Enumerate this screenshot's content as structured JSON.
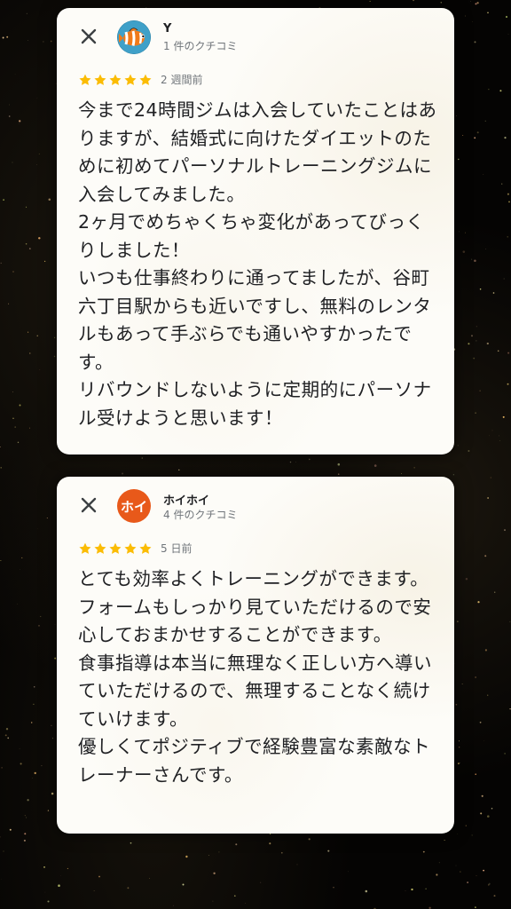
{
  "reviews": [
    {
      "reviewer_name": "Y",
      "review_count": "1 件のクチコミ",
      "rating": 5,
      "time_ago": "2 週間前",
      "avatar_icon": "clownfish-avatar",
      "text": "今まで24時間ジムは入会していたことはありますが、結婚式に向けたダイエットのために初めてパーソナルトレーニングジムに入会してみました。\n2ヶ月でめちゃくちゃ変化があってびっくりしました！\nいつも仕事終わりに通ってましたが、谷町六丁目駅からも近いですし、無料のレンタルもあって手ぶらでも通いやすかったです。\nリバウンドしないように定期的にパーソナル受けようと思います！"
    },
    {
      "reviewer_name": "ホイホイ",
      "review_count": "4 件のクチコミ",
      "rating": 5,
      "time_ago": "5 日前",
      "avatar_text": "ホイ",
      "avatar_color": "#e8591a",
      "text": "とても効率よくトレーニングができます。フォームもしっかり見ていただけるので安心しておまかせすることができます。\n食事指導は本当に無理なく正しい方へ導いていただけるので、無理することなく続けていけます。\n優しくてポジティブで経験豊富な素敵なトレーナーさんです。"
    }
  ],
  "colors": {
    "star": "#fbbc04",
    "card_bg": "#fdfcf8",
    "text": "#202124",
    "secondary_text": "#70757a",
    "background": "#050403"
  }
}
